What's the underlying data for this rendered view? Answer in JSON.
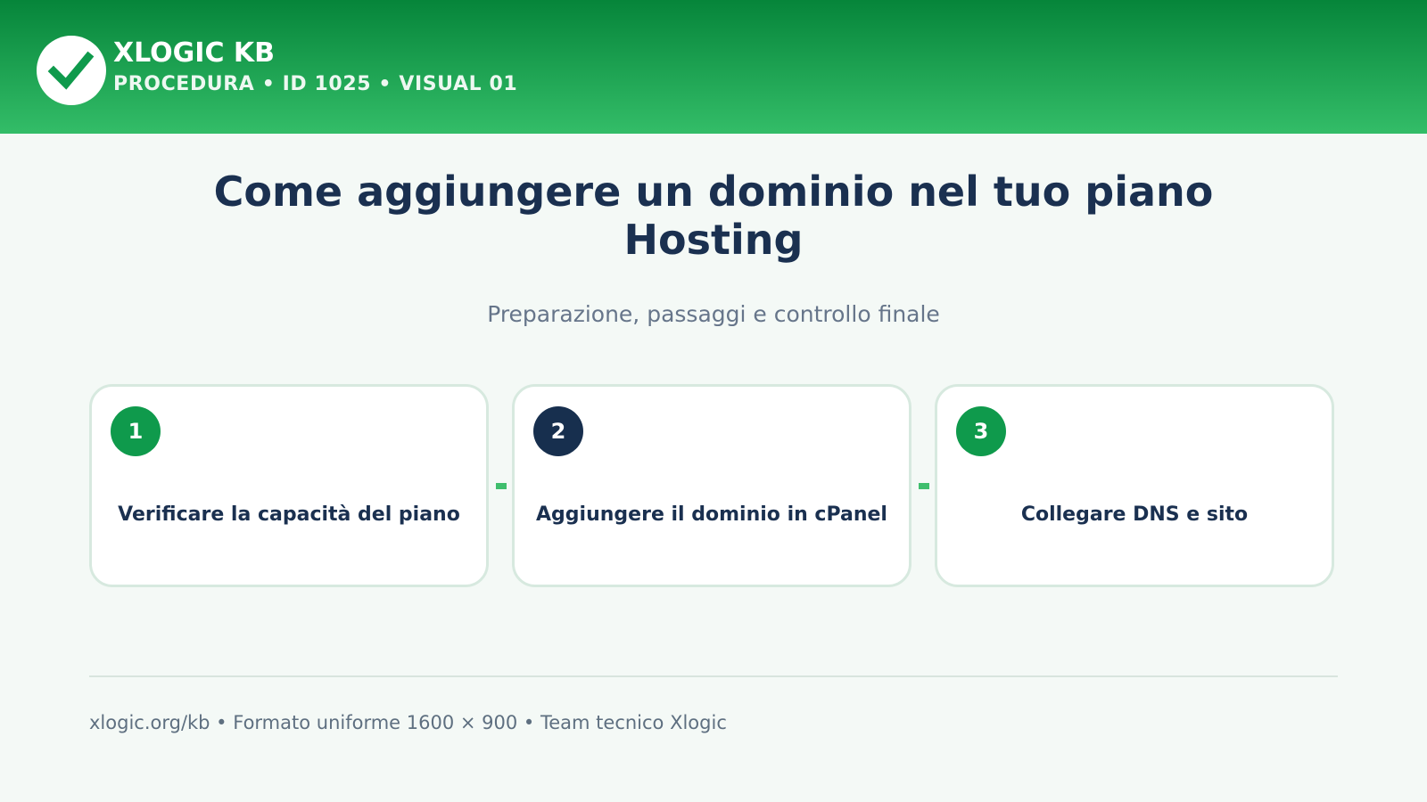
{
  "header": {
    "brand_name": "XLOGIC KB",
    "brand_sub": "PROCEDURA • ID 1025 • VISUAL 01",
    "logo_icon": "check-icon",
    "gradient_top": "#06853a",
    "gradient_bottom": "#33bd68"
  },
  "main": {
    "title": "Come aggiungere un dominio nel tuo piano Hosting",
    "subtitle": "Preparazione, passaggi e controllo finale"
  },
  "steps": [
    {
      "number": "1",
      "label": "Verificare la capacità del piano",
      "color": "#0f9a4c"
    },
    {
      "number": "2",
      "label": "Aggiungere il dominio in cPanel",
      "color": "#172f4e"
    },
    {
      "number": "3",
      "label": "Collegare DNS e sito",
      "color": "#0f9a4c"
    }
  ],
  "footer": {
    "text": "xlogic.org/kb • Formato uniforme 1600 × 900 • Team tecnico Xlogic"
  }
}
